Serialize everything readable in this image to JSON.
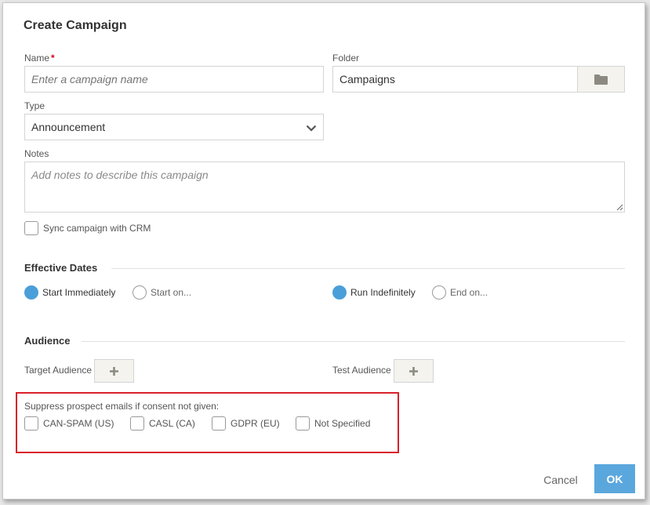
{
  "dialog": {
    "title": "Create Campaign"
  },
  "name": {
    "label": "Name",
    "required_mark": "*",
    "placeholder": "Enter a campaign name"
  },
  "folder": {
    "label": "Folder",
    "value": "Campaigns",
    "icon": "folder-icon"
  },
  "type": {
    "label": "Type",
    "value": "Announcement",
    "icon": "chevron-down-icon"
  },
  "notes": {
    "label": "Notes",
    "placeholder": "Add notes to describe this campaign"
  },
  "sync": {
    "label": "Sync campaign with CRM",
    "checked": false
  },
  "effective_dates": {
    "title": "Effective Dates",
    "start_immediately": "Start Immediately",
    "start_on": "Start on...",
    "run_indefinitely": "Run Indefinitely",
    "end_on": "End on..."
  },
  "audience": {
    "title": "Audience",
    "target_label": "Target Audience",
    "test_label": "Test Audience",
    "icon": "plus-icon"
  },
  "consent": {
    "label": "Suppress prospect emails if consent not given:",
    "options": [
      "CAN-SPAM (US)",
      "CASL (CA)",
      "GDPR (EU)",
      "Not Specified"
    ]
  },
  "footer": {
    "cancel": "Cancel",
    "ok": "OK"
  },
  "colors": {
    "accent": "#5aa7dd",
    "radio_selected": "#4a9fd8",
    "required": "#d0021b",
    "highlight": "#d9202a"
  }
}
